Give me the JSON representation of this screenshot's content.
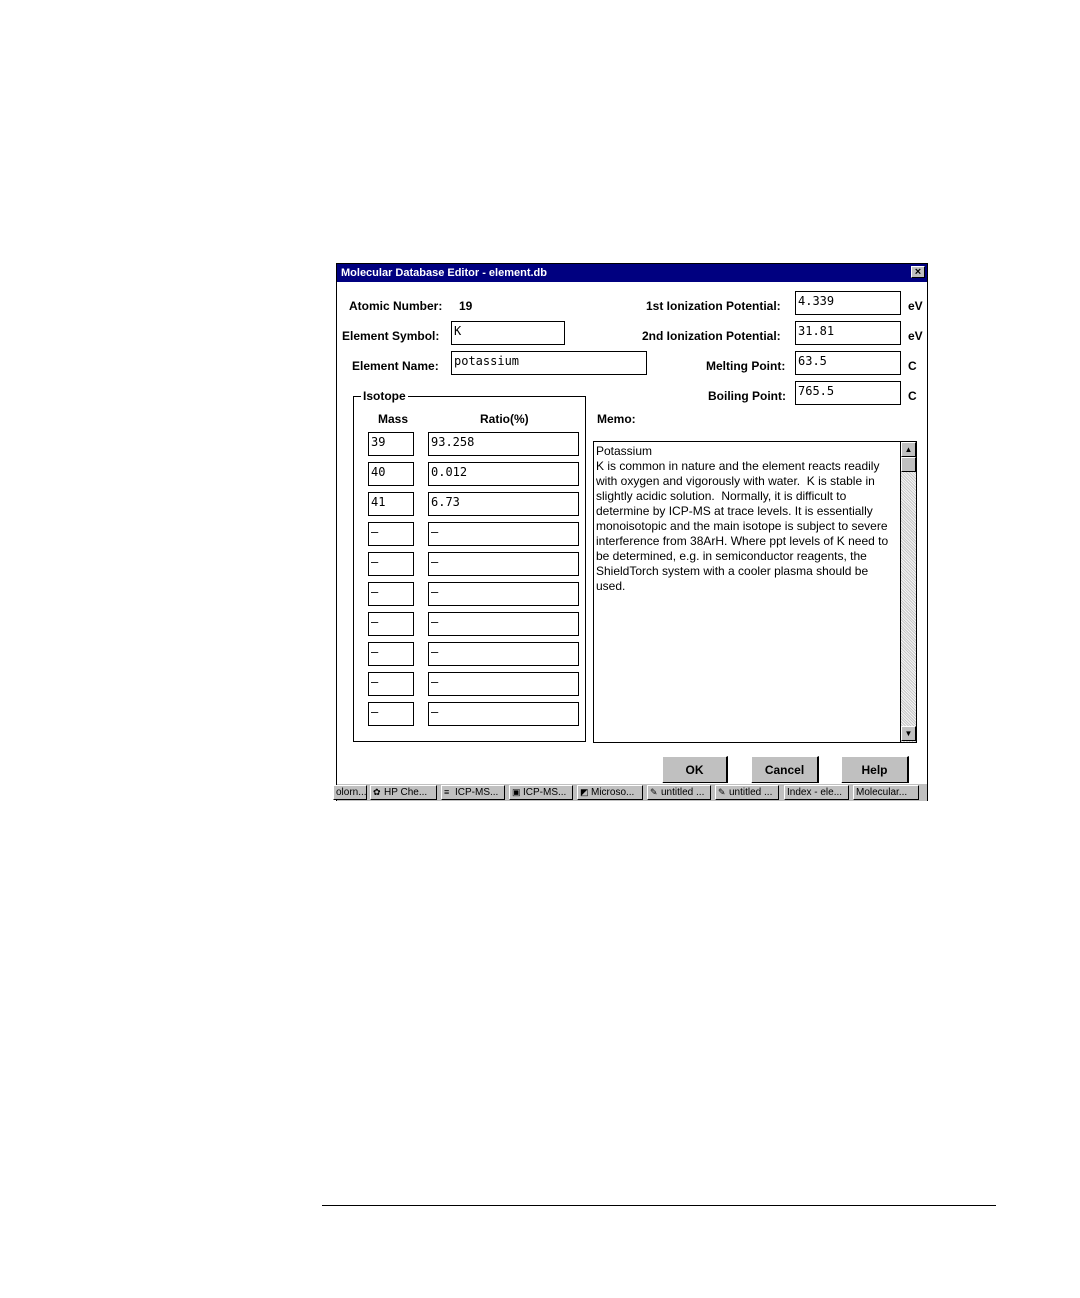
{
  "window": {
    "title": "Molecular Database Editor - element.db",
    "close_glyph": "×"
  },
  "fields": {
    "atomic_number_label": "Atomic Number:",
    "atomic_number_value": "19",
    "element_symbol_label": "Element Symbol:",
    "element_symbol_value": "K",
    "element_name_label": "Element Name:",
    "element_name_value": "potassium",
    "ion1_label": "1st Ionization Potential:",
    "ion1_value": "4.339",
    "ion1_unit": "eV",
    "ion2_label": "2nd Ionization Potential:",
    "ion2_value": "31.81",
    "ion2_unit": "eV",
    "melting_label": "Melting Point:",
    "melting_value": "63.5",
    "melting_unit": "C",
    "boiling_label": "Boiling Point:",
    "boiling_value": "765.5",
    "boiling_unit": "C"
  },
  "isotope": {
    "group_label": "Isotope",
    "mass_header": "Mass",
    "ratio_header": "Ratio(%)",
    "rows": [
      {
        "mass": "39",
        "ratio": "93.258"
      },
      {
        "mass": "40",
        "ratio": "0.012"
      },
      {
        "mass": "41",
        "ratio": "6.73"
      },
      {
        "mass": "—",
        "ratio": "—"
      },
      {
        "mass": "—",
        "ratio": "—"
      },
      {
        "mass": "—",
        "ratio": "—"
      },
      {
        "mass": "—",
        "ratio": "—"
      },
      {
        "mass": "—",
        "ratio": "—"
      },
      {
        "mass": "—",
        "ratio": "—"
      },
      {
        "mass": "—",
        "ratio": "—"
      }
    ]
  },
  "memo": {
    "label": "Memo:",
    "text": "Potassium\nK is common in nature and the element reacts readily with oxygen and vigorously with water.  K is stable in slightly acidic solution.  Normally, it is difficult to determine by ICP-MS at trace levels. It is essentially monoisotopic and the main isotope is subject to severe interference from 38ArH. Where ppt levels of K need to be determined, e.g. in semiconductor reagents, the ShieldTorch system with a cooler plasma should be used.",
    "scroll_up_glyph": "▲",
    "scroll_down_glyph": "▼"
  },
  "buttons": {
    "ok": "OK",
    "cancel": "Cancel",
    "help": "Help"
  },
  "taskbar": [
    {
      "label": "olorn...",
      "icon": ""
    },
    {
      "label": "HP Che...",
      "icon": "hp-chem-icon"
    },
    {
      "label": "ICP-MS...",
      "icon": "icp-ms-icon"
    },
    {
      "label": "ICP-MS...",
      "icon": "icp-ms-window-icon"
    },
    {
      "label": "Microso...",
      "icon": "microsoft-icon"
    },
    {
      "label": "untitled ...",
      "icon": "paint-icon"
    },
    {
      "label": "untitled ...",
      "icon": "paint-icon"
    },
    {
      "label": "Index - ele...",
      "icon": ""
    },
    {
      "label": "Molecular...",
      "icon": ""
    }
  ]
}
